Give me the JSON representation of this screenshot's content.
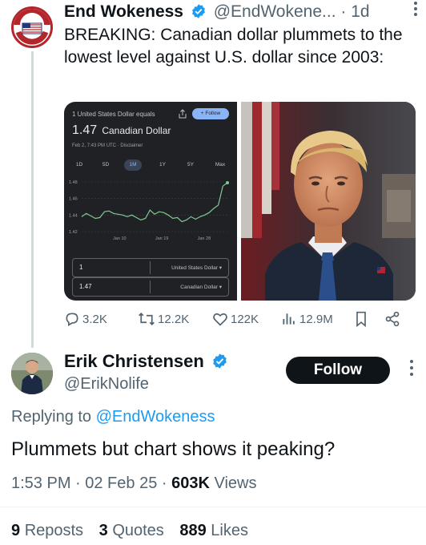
{
  "post": {
    "author_name": "End Wokeness",
    "author_handle": "@EndWokene...",
    "separator": "·",
    "time": "1d",
    "avatar_text_top": "I SUPPORT THE",
    "avatar_text_bottom": "FORMER PRESIDENT",
    "text": "BREAKING: Canadian dollar plummets to the lowest level against U.S. dollar since 2003:",
    "stats": {
      "replies": "3.2K",
      "reposts": "12.2K",
      "likes": "122K",
      "views": "12.9M"
    }
  },
  "currency_card": {
    "caption": "1 United States Dollar equals",
    "rate": "1.47",
    "currency": "Canadian Dollar",
    "date": "Feb 2, 7:43 PM UTC · Disclaimer",
    "follow_label": "+ Follow",
    "tabs": [
      "1D",
      "5D",
      "1M",
      "1Y",
      "5Y",
      "Max"
    ],
    "active_tab": "1M",
    "from_amount": "1",
    "from_currency": "United States Dollar",
    "to_amount": "1.47",
    "to_currency": "Canadian Dollar",
    "line_color": "#81c995"
  },
  "chart_data": {
    "type": "line",
    "title": "",
    "xlabel": "",
    "ylabel": "",
    "x_ticks": [
      "Jan 10",
      "Jan 19",
      "Jan 28"
    ],
    "y_ticks": [
      "1.48",
      "1.46",
      "1.44",
      "1.42"
    ],
    "ylim": [
      1.42,
      1.48
    ],
    "grid": true,
    "series": [
      {
        "values": [
          1.438,
          1.442,
          1.439,
          1.436,
          1.437,
          1.444,
          1.445,
          1.442,
          1.441,
          1.44,
          1.438,
          1.44,
          1.437,
          1.434,
          1.436,
          1.446,
          1.441,
          1.444,
          1.443,
          1.44,
          1.436,
          1.437,
          1.432,
          1.434,
          1.438,
          1.435,
          1.438,
          1.44,
          1.443,
          1.448,
          1.452,
          1.475,
          1.479
        ]
      }
    ]
  },
  "reply": {
    "author_name": "Erik Christensen",
    "author_handle": "@ErikNolife",
    "follow_label": "Follow",
    "replying_prefix": "Replying to",
    "replying_to": "@EndWokeness",
    "text": "Plummets but chart shows it peaking?",
    "time": "1:53 PM · 02 Feb 25 ·",
    "views_count": "603K",
    "views_label": "Views",
    "reposts_count": "9",
    "reposts_label": "Reposts",
    "quotes_count": "3",
    "quotes_label": "Quotes",
    "likes_count": "889",
    "likes_label": "Likes"
  },
  "colors": {
    "accent": "#1d9bf0",
    "text": "#0f1419",
    "muted": "#536471",
    "badge": "#1d9bf0"
  }
}
